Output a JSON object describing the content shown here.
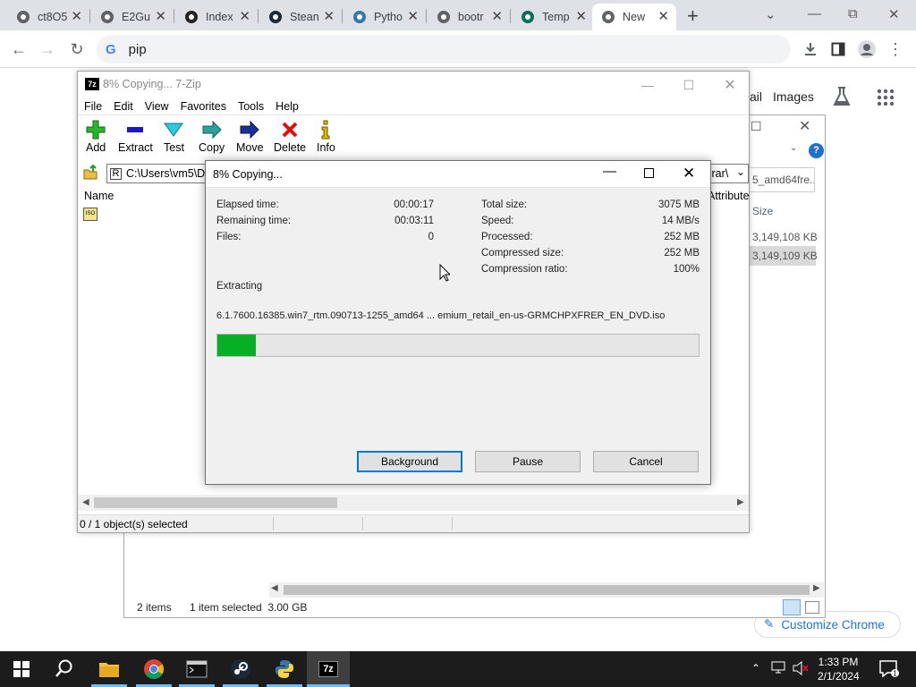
{
  "browser": {
    "tabs": [
      {
        "title": "ct8O5",
        "icon": "globe-icon"
      },
      {
        "title": "E2Gu",
        "icon": "globe-icon"
      },
      {
        "title": "Index",
        "icon": "index-icon"
      },
      {
        "title": "Stean",
        "icon": "steam-icon"
      },
      {
        "title": "Pytho",
        "icon": "python-icon"
      },
      {
        "title": "bootr",
        "icon": "globe-icon"
      },
      {
        "title": "Temp",
        "icon": "temp-icon"
      },
      {
        "title": "New",
        "icon": "chrome-icon"
      }
    ],
    "address": "pip",
    "new_tab_links": [
      "ail",
      "Images"
    ],
    "customize_label": "Customize Chrome"
  },
  "explorer": {
    "search_text": "5_amd64fre...",
    "col_size": "Size",
    "sizes": [
      "3,149,108 KB",
      "3,149,109 KB"
    ],
    "status_items": "2 items",
    "status_selected": "1 item selected  3.00 GB"
  },
  "sevenzip": {
    "title": "8% Copying... 7-Zip",
    "menu": [
      "File",
      "Edit",
      "View",
      "Favorites",
      "Tools",
      "Help"
    ],
    "toolbar": [
      {
        "label": "Add",
        "icon": "add-icon",
        "color": "#22aa22"
      },
      {
        "label": "Extract",
        "icon": "extract-icon",
        "color": "#2020c0"
      },
      {
        "label": "Test",
        "icon": "test-icon",
        "color": "#10a0c0"
      },
      {
        "label": "Copy",
        "icon": "copy-icon",
        "color": "#1b8a8a"
      },
      {
        "label": "Move",
        "icon": "move-icon",
        "color": "#1a2a8a"
      },
      {
        "label": "Delete",
        "icon": "delete-icon",
        "color": "#d01010"
      },
      {
        "label": "Info",
        "icon": "info-icon",
        "color": "#c0a000"
      }
    ],
    "path": "C:\\Users\\vm5\\D",
    "path_tail": ".rar\\",
    "col_name": "Name",
    "col_attrib": "Attribute",
    "status": "0 / 1 object(s) selected"
  },
  "dialog": {
    "title": "8% Copying...",
    "left_stats": [
      {
        "label": "Elapsed time:",
        "value": "00:00:17"
      },
      {
        "label": "Remaining time:",
        "value": "00:03:11"
      },
      {
        "label": "Files:",
        "value": "0"
      }
    ],
    "right_stats": [
      {
        "label": "Total size:",
        "value": "3075 MB"
      },
      {
        "label": "Speed:",
        "value": "14 MB/s"
      },
      {
        "label": "Processed:",
        "value": "252 MB"
      },
      {
        "label": "Compressed size:",
        "value": "252 MB"
      },
      {
        "label": "Compression ratio:",
        "value": "100%"
      }
    ],
    "operation": "Extracting",
    "filename": "6.1.7600.16385.win7_rtm.090713-1255_amd64 ... emium_retail_en-us-GRMCHPXFRER_EN_DVD.iso",
    "progress_fraction": 0.08,
    "progress_color": "#06b025",
    "buttons": {
      "background": "Background",
      "pause": "Pause",
      "cancel": "Cancel"
    }
  },
  "taskbar": {
    "time": "1:33 PM",
    "date": "2/1/2024",
    "apps": [
      "file-explorer-icon",
      "chrome-icon",
      "terminal-icon",
      "steam-icon",
      "python-icon",
      "7zip-icon"
    ]
  }
}
